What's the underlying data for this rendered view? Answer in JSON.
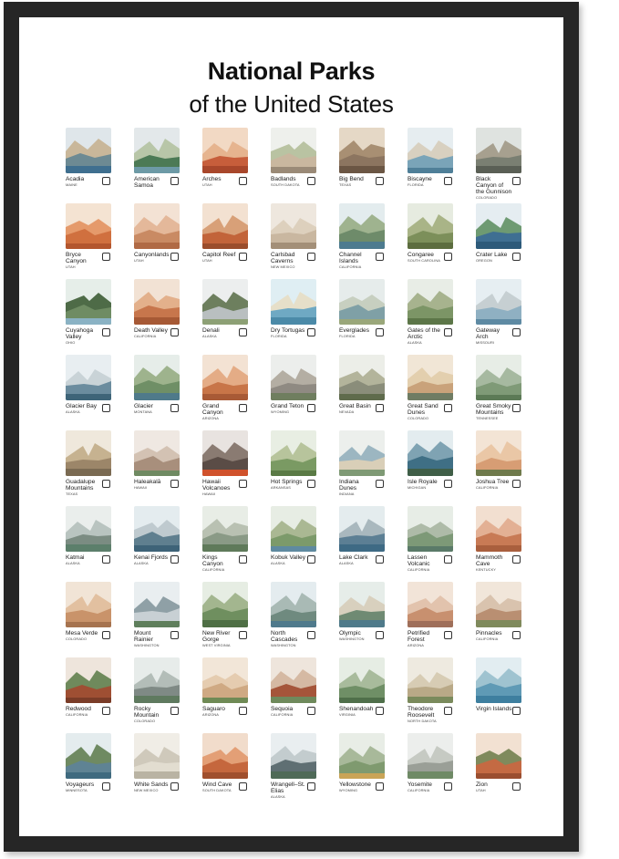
{
  "title": "National Parks",
  "subtitle": "of the United States",
  "parks": [
    {
      "name": "Acadia",
      "state": "MAINE",
      "palette": [
        "#dfe6ea",
        "#6d8a93",
        "#3f6f8f",
        "#c9b79a"
      ]
    },
    {
      "name": "American Samoa",
      "state": "",
      "palette": [
        "#e3e8ea",
        "#4c7a55",
        "#6d9aa6",
        "#b8c6a8"
      ]
    },
    {
      "name": "Arches",
      "state": "UTAH",
      "palette": [
        "#f2d9c4",
        "#c75e3b",
        "#a8472b",
        "#e6b48f"
      ]
    },
    {
      "name": "Badlands",
      "state": "SOUTH DAKOTA",
      "palette": [
        "#eef0ec",
        "#c9b79f",
        "#9a8a77",
        "#b9c3a2"
      ]
    },
    {
      "name": "Big Bend",
      "state": "TEXAS",
      "palette": [
        "#e5d8c6",
        "#8c7560",
        "#6b5644",
        "#a88f73"
      ]
    },
    {
      "name": "Biscayne",
      "state": "FLORIDA",
      "palette": [
        "#e6edf0",
        "#7aa4b8",
        "#4f7f98",
        "#d8d0c0"
      ]
    },
    {
      "name": "Black Canyon of the Gunnison",
      "state": "COLORADO",
      "palette": [
        "#dfe3e0",
        "#7a7f72",
        "#5a5f55",
        "#a7a08f"
      ]
    },
    {
      "name": "Bryce Canyon",
      "state": "UTAH",
      "palette": [
        "#f4e3d2",
        "#d0703f",
        "#b3562e",
        "#e59a6b"
      ]
    },
    {
      "name": "Canyonlands",
      "state": "UTAH",
      "palette": [
        "#f3e2d4",
        "#c98a63",
        "#b06a45",
        "#e4b89a"
      ]
    },
    {
      "name": "Capitol Reef",
      "state": "UTAH",
      "palette": [
        "#f3e1d1",
        "#c2643a",
        "#9a4d2c",
        "#d8a078"
      ]
    },
    {
      "name": "Carlsbad Caverns",
      "state": "NEW MEXICO",
      "palette": [
        "#eee7de",
        "#c9b7a0",
        "#a38f78",
        "#ddd0bd"
      ]
    },
    {
      "name": "Channel Islands",
      "state": "CALIFORNIA",
      "palette": [
        "#e3ecee",
        "#6e8b6a",
        "#4d7b8f",
        "#9fb38f"
      ]
    },
    {
      "name": "Congaree",
      "state": "SOUTH CAROLINA",
      "palette": [
        "#e6ebe0",
        "#7c8f5a",
        "#5c6d3f",
        "#a9b487"
      ]
    },
    {
      "name": "Crater Lake",
      "state": "OREGON",
      "palette": [
        "#e5edf1",
        "#3f6f92",
        "#2d5a7a",
        "#6e9a72"
      ]
    },
    {
      "name": "Cuyahoga Valley",
      "state": "OHIO",
      "palette": [
        "#e6eee9",
        "#6f8c63",
        "#8ab2c4",
        "#4e6b47"
      ]
    },
    {
      "name": "Death Valley",
      "state": "CALIFORNIA",
      "palette": [
        "#f2e2d4",
        "#c7764c",
        "#a65935",
        "#e3b08b"
      ]
    },
    {
      "name": "Denali",
      "state": "ALASKA",
      "palette": [
        "#eceeee",
        "#b9bfc0",
        "#8da075",
        "#6d7f5e"
      ]
    },
    {
      "name": "Dry Tortugas",
      "state": "FLORIDA",
      "palette": [
        "#dfeef3",
        "#6fa9c3",
        "#4b8aa8",
        "#e6dfc9"
      ]
    },
    {
      "name": "Everglades",
      "state": "FLORIDA",
      "palette": [
        "#e6eceb",
        "#7fa0a6",
        "#9aa77a",
        "#c7cfc0"
      ]
    },
    {
      "name": "Gates of the Arctic",
      "state": "ALASKA",
      "palette": [
        "#e8ede6",
        "#7c9566",
        "#5c7648",
        "#a7b38e"
      ]
    },
    {
      "name": "Gateway Arch",
      "state": "MISSOURI",
      "palette": [
        "#e6eef2",
        "#8fb0c2",
        "#5e8aa3",
        "#c6cfd2"
      ]
    },
    {
      "name": "Glacier Bay",
      "state": "ALASKA",
      "palette": [
        "#e8eef1",
        "#6b8c9e",
        "#3e6478",
        "#c9d3d7"
      ]
    },
    {
      "name": "Glacier",
      "state": "MONTANA",
      "palette": [
        "#e6ede9",
        "#6f8f66",
        "#4f7a8a",
        "#9eb38d"
      ]
    },
    {
      "name": "Grand Canyon",
      "state": "ARIZONA",
      "palette": [
        "#f3e2d3",
        "#c87548",
        "#a85a36",
        "#e4ac86"
      ]
    },
    {
      "name": "Grand Teton",
      "state": "WYOMING",
      "palette": [
        "#eceeec",
        "#8f8a82",
        "#6f7e5f",
        "#b4aea3"
      ]
    },
    {
      "name": "Great Basin",
      "state": "NEVADA",
      "palette": [
        "#eceee8",
        "#8a8d7a",
        "#5f6b4c",
        "#b3b49b"
      ]
    },
    {
      "name": "Great Sand Dunes",
      "state": "COLORADO",
      "palette": [
        "#f1e6d6",
        "#c9a27a",
        "#6f7c63",
        "#e3cfae"
      ]
    },
    {
      "name": "Great Smoky Mountains",
      "state": "TENNESSEE",
      "palette": [
        "#e7ede6",
        "#7f9a77",
        "#5c7a56",
        "#a6b9a0"
      ]
    },
    {
      "name": "Guadalupe Mountains",
      "state": "TEXAS",
      "palette": [
        "#efe8dc",
        "#9c8669",
        "#7a6a52",
        "#c6b290"
      ]
    },
    {
      "name": "Haleakalā",
      "state": "HAWAII",
      "palette": [
        "#efe8e2",
        "#a88f7c",
        "#6f8a62",
        "#d3c2b3"
      ]
    },
    {
      "name": "Hawaii Volcanoes",
      "state": "HAWAII",
      "palette": [
        "#e8e3e0",
        "#5a4c46",
        "#d0522c",
        "#8a7b72"
      ]
    },
    {
      "name": "Hot Springs",
      "state": "ARKANSAS",
      "palette": [
        "#e8eee3",
        "#7a9a63",
        "#5a7a45",
        "#b7c49c"
      ]
    },
    {
      "name": "Indiana Dunes",
      "state": "INDIANA",
      "palette": [
        "#ecefec",
        "#d9cfb8",
        "#7f9a75",
        "#9cb6c1"
      ]
    },
    {
      "name": "Isle Royale",
      "state": "MICHIGAN",
      "palette": [
        "#e3ecef",
        "#3f6f85",
        "#3f5e47",
        "#7fa3b3"
      ]
    },
    {
      "name": "Joshua Tree",
      "state": "CALIFORNIA",
      "palette": [
        "#f3e4d5",
        "#d79d74",
        "#6f7a4c",
        "#eac7a6"
      ]
    },
    {
      "name": "Katmai",
      "state": "ALASKA",
      "palette": [
        "#eaeeec",
        "#7b8c82",
        "#5c7f6b",
        "#b9c4c0"
      ]
    },
    {
      "name": "Kenai Fjords",
      "state": "ALASKA",
      "palette": [
        "#e4ecef",
        "#5f7f8f",
        "#3e6378",
        "#bfcacf"
      ]
    },
    {
      "name": "Kings Canyon",
      "state": "CALIFORNIA",
      "palette": [
        "#e8ede6",
        "#8a9a86",
        "#5f7a5a",
        "#b9c1b2"
      ]
    },
    {
      "name": "Kobuk Valley",
      "state": "ALASKA",
      "palette": [
        "#e7ede4",
        "#7c9a6a",
        "#5f8aa0",
        "#aab893"
      ]
    },
    {
      "name": "Lake Clark",
      "state": "ALASKA",
      "palette": [
        "#e4ecee",
        "#5c7f94",
        "#3e6a84",
        "#a9b8be"
      ]
    },
    {
      "name": "Lassen Volcanic",
      "state": "CALIFORNIA",
      "palette": [
        "#e7ede6",
        "#7d9977",
        "#5a7a68",
        "#aebba8"
      ]
    },
    {
      "name": "Mammoth Cave",
      "state": "KENTUCKY",
      "palette": [
        "#f2dfd0",
        "#c87a55",
        "#a95f3e",
        "#e3b094"
      ]
    },
    {
      "name": "Mesa Verde",
      "state": "COLORADO",
      "palette": [
        "#f1e4d6",
        "#c9936a",
        "#a6734f",
        "#e2c0a0"
      ]
    },
    {
      "name": "Mount Rainier",
      "state": "WASHINGTON",
      "palette": [
        "#e9eef0",
        "#c8d0d4",
        "#5f7f5c",
        "#8fa0a6"
      ]
    },
    {
      "name": "New River Gorge",
      "state": "WEST VIRGINIA",
      "palette": [
        "#e6ede3",
        "#6f8f5f",
        "#4f6f45",
        "#a3b68f"
      ]
    },
    {
      "name": "North Cascades",
      "state": "WASHINGTON",
      "palette": [
        "#e4ecef",
        "#6f8a7f",
        "#4f7a8c",
        "#a9bab5"
      ]
    },
    {
      "name": "Olympic",
      "state": "WASHINGTON",
      "palette": [
        "#e6ede9",
        "#6f8a73",
        "#4f7a8a",
        "#d8d0be"
      ]
    },
    {
      "name": "Petrified Forest",
      "state": "ARIZONA",
      "palette": [
        "#f2e4d8",
        "#c8906f",
        "#9f6f5a",
        "#e2c3ad"
      ]
    },
    {
      "name": "Pinnacles",
      "state": "CALIFORNIA",
      "palette": [
        "#f1e6da",
        "#b98f72",
        "#7f8a5c",
        "#d9c3ae"
      ]
    },
    {
      "name": "Redwood",
      "state": "CALIFORNIA",
      "palette": [
        "#eee5dc",
        "#9f4f33",
        "#7a3c28",
        "#6f8a5c"
      ]
    },
    {
      "name": "Rocky Mountain",
      "state": "COLORADO",
      "palette": [
        "#e7ecea",
        "#7f8a85",
        "#5f7a5f",
        "#b3bdb8"
      ]
    },
    {
      "name": "Saguaro",
      "state": "ARIZONA",
      "palette": [
        "#f2e6d8",
        "#cfa983",
        "#6f8a55",
        "#e5ccb0"
      ]
    },
    {
      "name": "Sequoia",
      "state": "CALIFORNIA",
      "palette": [
        "#eee5dc",
        "#a5553a",
        "#6f8a5c",
        "#d5b9a3"
      ]
    },
    {
      "name": "Shenandoah",
      "state": "VIRGINIA",
      "palette": [
        "#e6ede4",
        "#6f8f66",
        "#4f6f4a",
        "#a8bb9c"
      ]
    },
    {
      "name": "Theodore Roosevelt",
      "state": "NORTH DAKOTA",
      "palette": [
        "#eeeae0",
        "#b9a987",
        "#7a8a5c",
        "#d7ccb4"
      ]
    },
    {
      "name": "Virgin Islands",
      "state": "",
      "palette": [
        "#e2edf1",
        "#5f9ab5",
        "#3e7f9f",
        "#9fc3d0"
      ]
    },
    {
      "name": "Voyageurs",
      "state": "MINNESOTA",
      "palette": [
        "#e4ecee",
        "#5f8394",
        "#3f6a7f",
        "#6f8a62"
      ]
    },
    {
      "name": "White Sands",
      "state": "NEW MEXICO",
      "palette": [
        "#f0ede6",
        "#e2ddd0",
        "#b9b3a3",
        "#cfc9bb"
      ]
    },
    {
      "name": "Wind Cave",
      "state": "SOUTH DAKOTA",
      "palette": [
        "#f1dccb",
        "#c5673d",
        "#a04f2d",
        "#e39f76"
      ]
    },
    {
      "name": "Wrangell–St. Elias",
      "state": "ALASKA",
      "palette": [
        "#e9eef0",
        "#5f6f73",
        "#4f6a58",
        "#c3ccce"
      ]
    },
    {
      "name": "Yellowstone",
      "state": "WYOMING",
      "palette": [
        "#e8ede6",
        "#7f9a6f",
        "#c9a457",
        "#a8b99a"
      ]
    },
    {
      "name": "Yosemite",
      "state": "CALIFORNIA",
      "palette": [
        "#eceeec",
        "#9a9f97",
        "#6f8a66",
        "#c6cac3"
      ]
    },
    {
      "name": "Zion",
      "state": "UTAH",
      "palette": [
        "#f2e1d2",
        "#c46a43",
        "#9a4e30",
        "#7f8a5c"
      ]
    }
  ]
}
